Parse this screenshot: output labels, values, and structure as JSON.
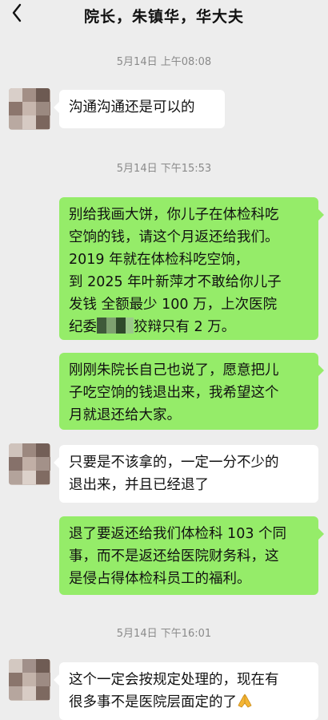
{
  "header": {
    "back_icon": "chevron-left-icon",
    "title": "院长，朱镇华，华大夫"
  },
  "messages": [
    {
      "type": "timestamp",
      "text": "5月14日 上午08:08"
    },
    {
      "type": "received",
      "text": "沟通沟通还是可以的"
    },
    {
      "type": "timestamp",
      "text": "5月14日 下午15:53"
    },
    {
      "type": "sent",
      "lines": [
        "别给我画大饼，你儿子在体检科吃",
        "空饷的钱，请这个月返还给我们。",
        "2019 年就在体检科吃空饷，",
        "到 2025 年叶新萍才不敢给你儿子",
        "发钱  全额最少 100 万，上次医院",
        "纪委",
        "狡辩只有 2 万。"
      ]
    },
    {
      "type": "sent",
      "lines": [
        "刚刚朱院长自己也说了，愿意把儿",
        "子吃空饷的钱退出来，我希望这个",
        "月就退还给大家。"
      ]
    },
    {
      "type": "received",
      "lines": [
        "只要是不该拿的，一定一分不少的",
        "退出来，并且已经退了"
      ]
    },
    {
      "type": "sent",
      "lines": [
        "退了要返还给我们体检科 103 个同",
        "事，而不是返还给医院财务科，这",
        "是侵占得体检科员工的福利。"
      ]
    },
    {
      "type": "timestamp",
      "text": "5月14日 下午16:01"
    },
    {
      "type": "received",
      "lines": [
        "这个一定会按规定处理的，现在有",
        "很多事不是医院层面定的了"
      ]
    }
  ]
}
